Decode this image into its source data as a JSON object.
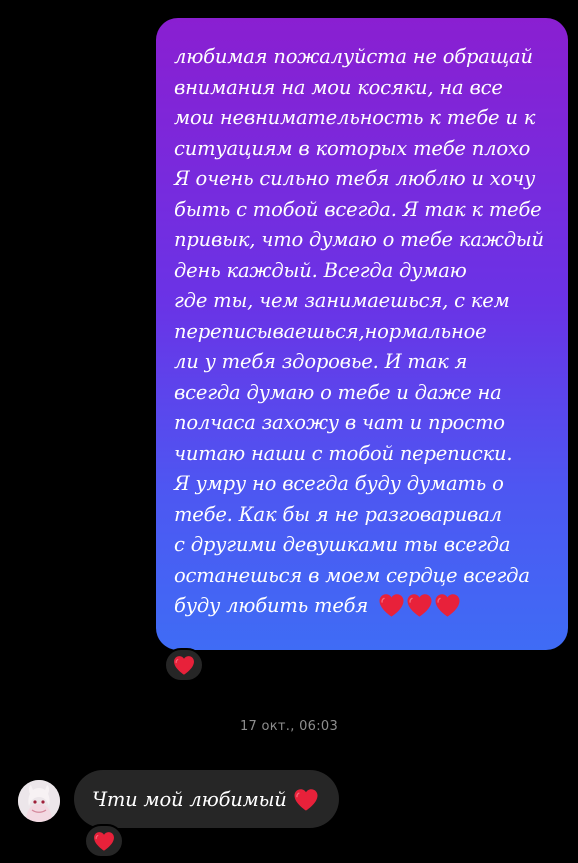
{
  "chat": {
    "outgoing_message": "любимая пожалуйста не обращай\nвнимания на мои косяки, на все\nмои невнимательность к тебе и к\nситуациям в которых тебе плохо\nЯ очень сильно тебя люблю и хочу\nбыть с тобой всегда. Я так к тебе\nпривык, что думаю о тебе каждый\nдень каждый. Всегда думаю\nгде ты, чем занимаешься, с кем\nпереписываешься,нормальное\nли у тебя здоровье. И так я\nвсегда думаю о тебе и даже на\nполчаса захожу в чат и просто\nчитаю наши с тобой переписки.\nЯ умру но всегда буду думать о\nтебе. Как бы я не разговаривал\nс другими девушками ты всегда\nостанешься в моем сердце всегда\nбуду любить тебя",
    "outgoing_emoji": [
      "red-heart",
      "red-heart",
      "red-heart"
    ],
    "outgoing_reaction": "red-heart",
    "timestamp": "17 окт., 06:03",
    "incoming_message": "Чти мой любимый",
    "incoming_emoji": "red-heart",
    "incoming_reaction": "red-heart",
    "avatar": "contact-avatar"
  },
  "colors": {
    "background": "#000000",
    "bubble_gradient_top": "#8a1fd1",
    "bubble_gradient_bottom": "#3f6cf5",
    "incoming_bubble": "#262626",
    "heart": "#e8213a",
    "timestamp": "#8e8e8e"
  }
}
